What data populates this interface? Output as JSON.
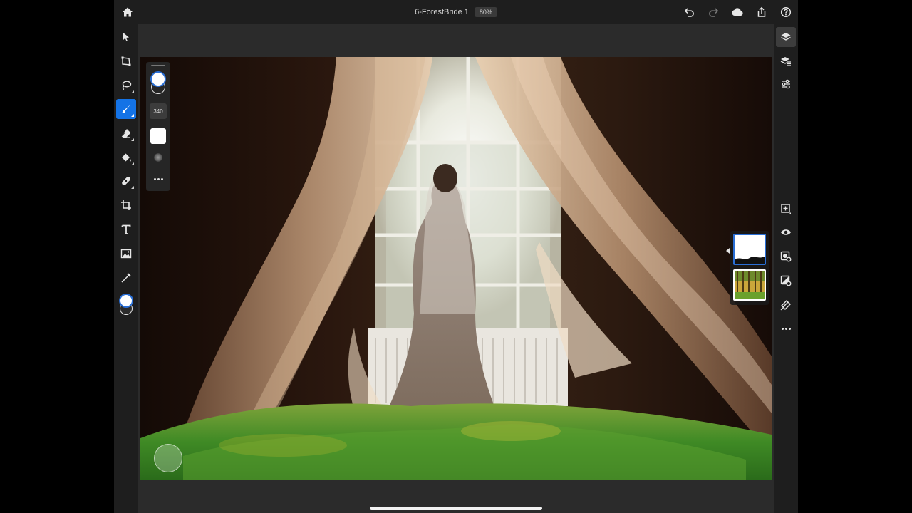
{
  "header": {
    "document_title": "6-ForestBride 1",
    "zoom": "80%"
  },
  "toolbar": {
    "tools": [
      {
        "name": "select-tool",
        "icon": "arrow-cursor-icon"
      },
      {
        "name": "transform-tool",
        "icon": "transform-icon"
      },
      {
        "name": "lasso-tool",
        "icon": "lasso-icon"
      },
      {
        "name": "brush-tool",
        "icon": "brush-icon",
        "active": true
      },
      {
        "name": "eraser-tool",
        "icon": "eraser-icon"
      },
      {
        "name": "fill-tool",
        "icon": "paint-bucket-icon"
      },
      {
        "name": "healing-tool",
        "icon": "healing-brush-icon"
      },
      {
        "name": "crop-tool",
        "icon": "crop-icon"
      },
      {
        "name": "type-tool",
        "icon": "type-icon"
      },
      {
        "name": "place-image-tool",
        "icon": "image-icon"
      },
      {
        "name": "eyedropper-tool",
        "icon": "eyedropper-icon"
      }
    ]
  },
  "brush_panel": {
    "size": "340"
  },
  "colors": {
    "accent": "#1473e6",
    "foreground": "#ffffff",
    "chrome": "#1e1e1e",
    "workspace": "#2b2b2b"
  },
  "rightbar": {
    "icons": [
      "layers-icon",
      "layer-properties-icon",
      "adjustments-icon",
      "add-layer-icon",
      "visibility-eye-icon",
      "mask-icon",
      "adjustment-layer-icon",
      "clipping-icon",
      "more-icon"
    ]
  },
  "layers": [
    {
      "name": "mask-layer",
      "selected": true
    },
    {
      "name": "forest-layer",
      "selected": false
    }
  ]
}
